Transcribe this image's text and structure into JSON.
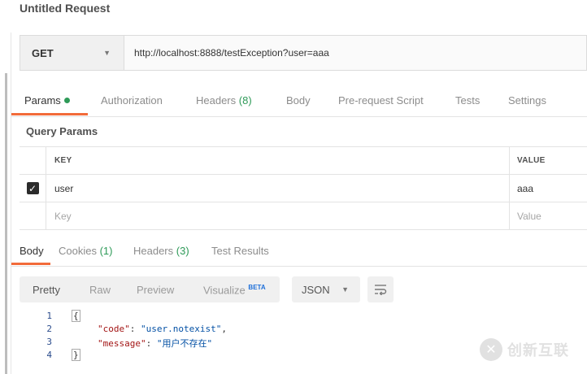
{
  "request": {
    "title": "Untitled Request",
    "method": "GET",
    "url": "http://localhost:8888/testException?user=aaa"
  },
  "request_tabs": [
    {
      "label": "Params",
      "count": "",
      "active": true
    },
    {
      "label": "Authorization",
      "count": ""
    },
    {
      "label": "Headers",
      "count": "(8)"
    },
    {
      "label": "Body",
      "count": ""
    },
    {
      "label": "Pre-request Script",
      "count": ""
    },
    {
      "label": "Tests",
      "count": ""
    },
    {
      "label": "Settings",
      "count": ""
    }
  ],
  "query_params": {
    "title": "Query Params",
    "headers": {
      "key": "KEY",
      "value": "VALUE"
    },
    "rows": [
      {
        "checked": true,
        "key": "user",
        "value": "aaa"
      }
    ],
    "placeholder": {
      "key": "Key",
      "value": "Value"
    }
  },
  "response_tabs": [
    {
      "label": "Body",
      "count": "",
      "active": true
    },
    {
      "label": "Cookies",
      "count": "(1)"
    },
    {
      "label": "Headers",
      "count": "(3)"
    },
    {
      "label": "Test Results",
      "count": ""
    }
  ],
  "view_modes": [
    {
      "label": "Pretty",
      "active": true
    },
    {
      "label": "Raw"
    },
    {
      "label": "Preview"
    },
    {
      "label": "Visualize",
      "badge": "BETA"
    }
  ],
  "format": "JSON",
  "code": {
    "line_numbers": [
      "1",
      "2",
      "3",
      "4"
    ],
    "open_brace": "{",
    "close_brace": "}",
    "entries": [
      {
        "key": "\"code\"",
        "sep": ": ",
        "value": "\"user.notexist\"",
        "comma": ","
      },
      {
        "key": "\"message\"",
        "sep": ": ",
        "value": "\"用户不存在\"",
        "comma": ""
      }
    ]
  },
  "watermark": "创新互联",
  "colors": {
    "accent": "#f26b3a",
    "count_green": "#2e9a58",
    "json_key": "#a31515",
    "json_string": "#0451a5",
    "beta_blue": "#1e6fd9"
  },
  "icons": [
    "caret-down-icon",
    "check-icon",
    "wrap-lines-icon"
  ]
}
